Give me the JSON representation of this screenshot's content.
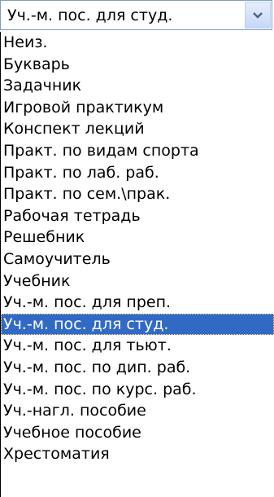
{
  "combo": {
    "value": "Уч.-м. пос. для студ.",
    "arrow_icon": "chevron-down-icon"
  },
  "colors": {
    "selection_bg": "#316ac5",
    "selection_fg": "#ffffff",
    "combo_border": "#7f9db9"
  },
  "list": {
    "selected_index": 13,
    "items": [
      "Неиз.",
      "Букварь",
      "Задачник",
      "Игровой практикум",
      "Конспект лекций",
      "Практ. по видам спорта",
      "Практ. по лаб. раб.",
      "Практ. по сем.\\прак.",
      "Рабочая тетрадь",
      "Решебник",
      "Самоучитель",
      "Учебник",
      "Уч.-м. пос. для преп.",
      "Уч.-м. пос. для студ.",
      "Уч.-м. пос. для тьют.",
      "Уч.-м. пос. по дип. раб.",
      "Уч.-м. пос. по курс. раб.",
      "Уч.-нагл. пособие",
      "Учебное пособие",
      "Хрестоматия"
    ]
  }
}
